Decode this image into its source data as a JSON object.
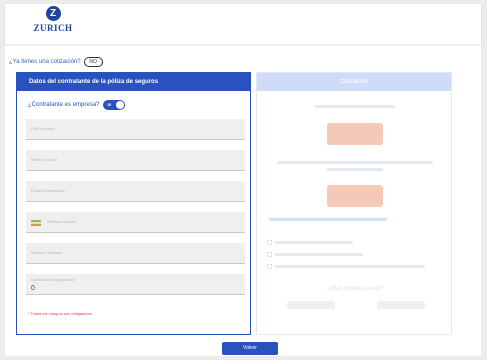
{
  "brand": {
    "logo_text": "ZURICH",
    "logo_mark": "Z"
  },
  "quote_question": "¿Ya tienes una cotización?",
  "quote_toggle_label": "NO",
  "left_panel": {
    "title": "Datos del contratante de la póliza de seguros",
    "company_question": "¿Contratante es empresa?",
    "company_toggle_label": "SI",
    "fields": [
      {
        "placeholder": "Full Empresa *",
        "value": ""
      },
      {
        "placeholder": "Razón Social *",
        "value": ""
      },
      {
        "placeholder": "Email Empresarial *",
        "value": ""
      },
      {
        "placeholder": "Teléfono Celular *",
        "value": ""
      },
      {
        "placeholder": "Nombre Contacto *",
        "value": ""
      },
      {
        "placeholder": "Cantidad de Empleados *",
        "value": "0"
      }
    ],
    "required_note": "* Todos los campos son obligatorios"
  },
  "right_panel": {
    "title": "Cotización",
    "question": "¿Qué quieres hacer?"
  },
  "footer": {
    "button_label": "Volver"
  },
  "colors": {
    "primary": "#2a52be",
    "accent_light": "#f5c9b8",
    "field_bg": "#efefef"
  }
}
